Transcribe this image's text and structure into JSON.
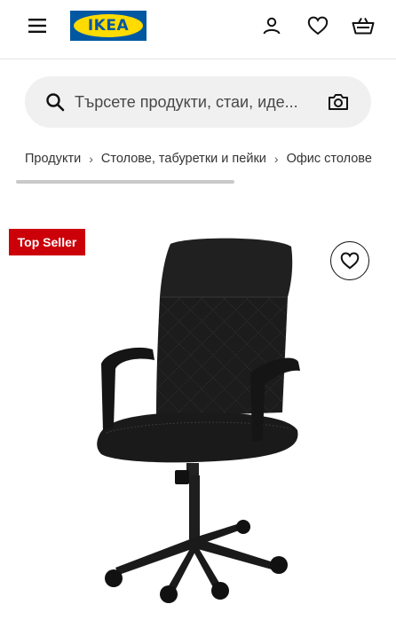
{
  "header": {
    "menu_icon": "hamburger-menu-icon",
    "logo": {
      "text": "IKEA",
      "brand_blue": "#0058a3",
      "brand_yellow": "#ffdb00"
    },
    "account_icon": "person-icon",
    "wishlist_icon": "heart-icon",
    "basket_icon": "basket-icon"
  },
  "search": {
    "placeholder": "Търсете продукти, стаи, иде...",
    "icon": "magnifier-icon",
    "camera_icon": "camera-icon"
  },
  "breadcrumb": {
    "items": [
      "Продукти",
      "Столове, табуретки и пейки",
      "Офис столове"
    ],
    "separator": "›"
  },
  "product": {
    "badge": "Top Seller",
    "badge_color": "#cc0008",
    "favorite_icon": "heart-outline-icon"
  }
}
